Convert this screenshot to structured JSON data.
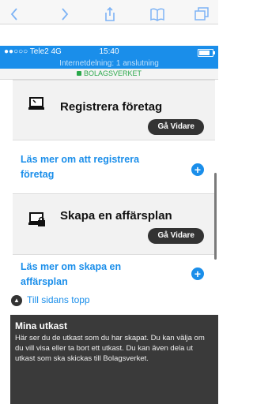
{
  "status_bar": {
    "carrier": "●●○○○ Tele2  4G",
    "time": "15:40"
  },
  "hotspot": {
    "text": "Internetdelning: 1 anslutning"
  },
  "url_bar": {
    "site": "BOLAGSVERKET"
  },
  "browser_toolbar": {
    "icons": [
      "back-arrow-icon",
      "forward-arrow-icon",
      "share-icon",
      "bookmarks-icon",
      "tabs-icon"
    ]
  },
  "cards": {
    "register": {
      "heading": "Registrera företag",
      "button": "Gå Vidare",
      "icon": "laptop-icon"
    },
    "register_more": {
      "link": "Läs mer om att registrera företag"
    },
    "plan": {
      "heading": "Skapa en affärsplan",
      "button": "Gå Vidare",
      "icon": "computer-lock-icon"
    },
    "plan_more": {
      "link": "Läs mer om skapa en affärsplan"
    }
  },
  "top_link": {
    "label": "Till sidans topp"
  },
  "drafts": {
    "title": "Mina utkast",
    "body": "Här ser du de utkast som du har skapat. Du kan välja om du vill visa eller ta bort ett utkast. Du kan även dela ut utkast som ska skickas till Bolagsverket."
  },
  "colors": {
    "accent_blue": "#1a8eea",
    "button_dark": "#333333",
    "lock_green": "#2aa84a",
    "panel_dark": "#3a3a3a"
  }
}
